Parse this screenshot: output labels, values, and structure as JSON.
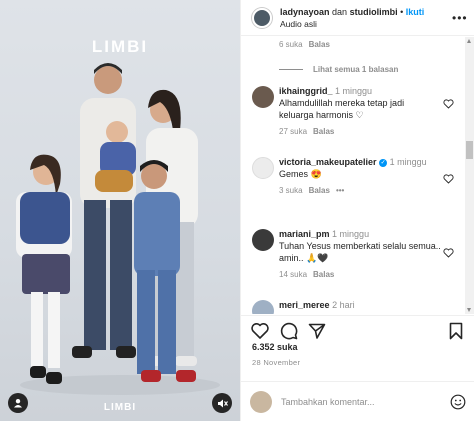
{
  "media": {
    "brand_top": "LIMBI",
    "brand_bottom": "LIMBI",
    "user_icon": "user-tag-icon",
    "mute_icon": "speaker-muted-icon"
  },
  "header": {
    "user1": "ladynayoan",
    "joiner": "dan",
    "user2": "studiolimbi",
    "dot": "•",
    "follow": "Ikuti",
    "audio": "Audio asli",
    "more_icon": "more-icon"
  },
  "top_meta": {
    "likes": "6 suka",
    "reply": "Balas"
  },
  "view_replies": "Lihat semua 1 balasan",
  "comments": [
    {
      "user": "ikhainggrid_",
      "time": "1 minggu",
      "text": "Alhamdulillah mereka tetap jadi keluarga harmonis ♡",
      "likes": "27 suka",
      "reply": "Balas",
      "avatar_color": "#6a5a4e"
    },
    {
      "user": "victoria_makeupatelier",
      "time": "1 minggu",
      "text": "Gemes 😍",
      "likes": "3 suka",
      "reply": "Balas",
      "more": "•••",
      "avatar_color": "#e8e8e8"
    },
    {
      "user": "mariani_pm",
      "time": "1 minggu",
      "text": "Tuhan Yesus memberkati selalu semua.. amin.. 🙏🖤",
      "likes": "14 suka",
      "reply": "Balas",
      "avatar_color": "#3a3a3a"
    },
    {
      "user": "meri_meree",
      "time": "2 hari",
      "text": "",
      "avatar_color": "#9fb0c4"
    }
  ],
  "actions": {
    "like_icon": "heart-icon",
    "comment_icon": "comment-icon",
    "share_icon": "share-icon",
    "save_icon": "bookmark-icon"
  },
  "post": {
    "likes": "6.352 suka",
    "date": "28 November"
  },
  "composer": {
    "placeholder": "Tambahkan komentar...",
    "emoji_icon": "emoji-icon"
  },
  "colors": {
    "link": "#0095f6",
    "muted": "#8e8e8e",
    "text": "#262626"
  }
}
